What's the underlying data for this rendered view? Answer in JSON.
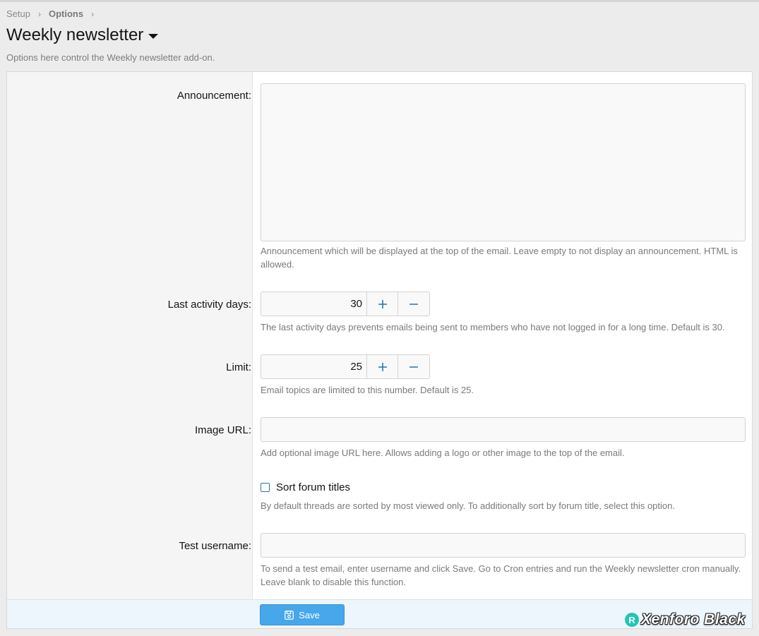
{
  "breadcrumb": {
    "items": [
      "Setup",
      "Options"
    ]
  },
  "page": {
    "title": "Weekly newsletter",
    "description": "Options here control the Weekly newsletter add-on."
  },
  "fields": {
    "announcement": {
      "label": "Announcement:",
      "value": "",
      "hint": "Announcement which will be displayed at the top of the email. Leave empty to not display an announcement. HTML is allowed."
    },
    "last_activity_days": {
      "label": "Last activity days:",
      "value": "30",
      "hint": "The last activity days prevents emails being sent to members who have not logged in for a long time. Default is 30."
    },
    "limit": {
      "label": "Limit:",
      "value": "25",
      "hint": "Email topics are limited to this number. Default is 25."
    },
    "image_url": {
      "label": "Image URL:",
      "value": "",
      "hint": "Add optional image URL here. Allows adding a logo or other image to the top of the email."
    },
    "sort_forum_titles": {
      "label": "Sort forum titles",
      "checked": false,
      "hint": "By default threads are sorted by most viewed only. To additionally sort by forum title, select this option."
    },
    "test_username": {
      "label": "Test username:",
      "value": "",
      "hint": "To send a test email, enter username and click Save. Go to Cron entries and run the Weekly newsletter cron manually. Leave blank to disable this function."
    }
  },
  "footer": {
    "save_label": "Save"
  },
  "watermark": {
    "symbol": "R",
    "text": "Xenforo Black"
  },
  "colors": {
    "accent": "#2577b1",
    "button": "#47a7eb",
    "footer_bg": "#edf6fd"
  }
}
